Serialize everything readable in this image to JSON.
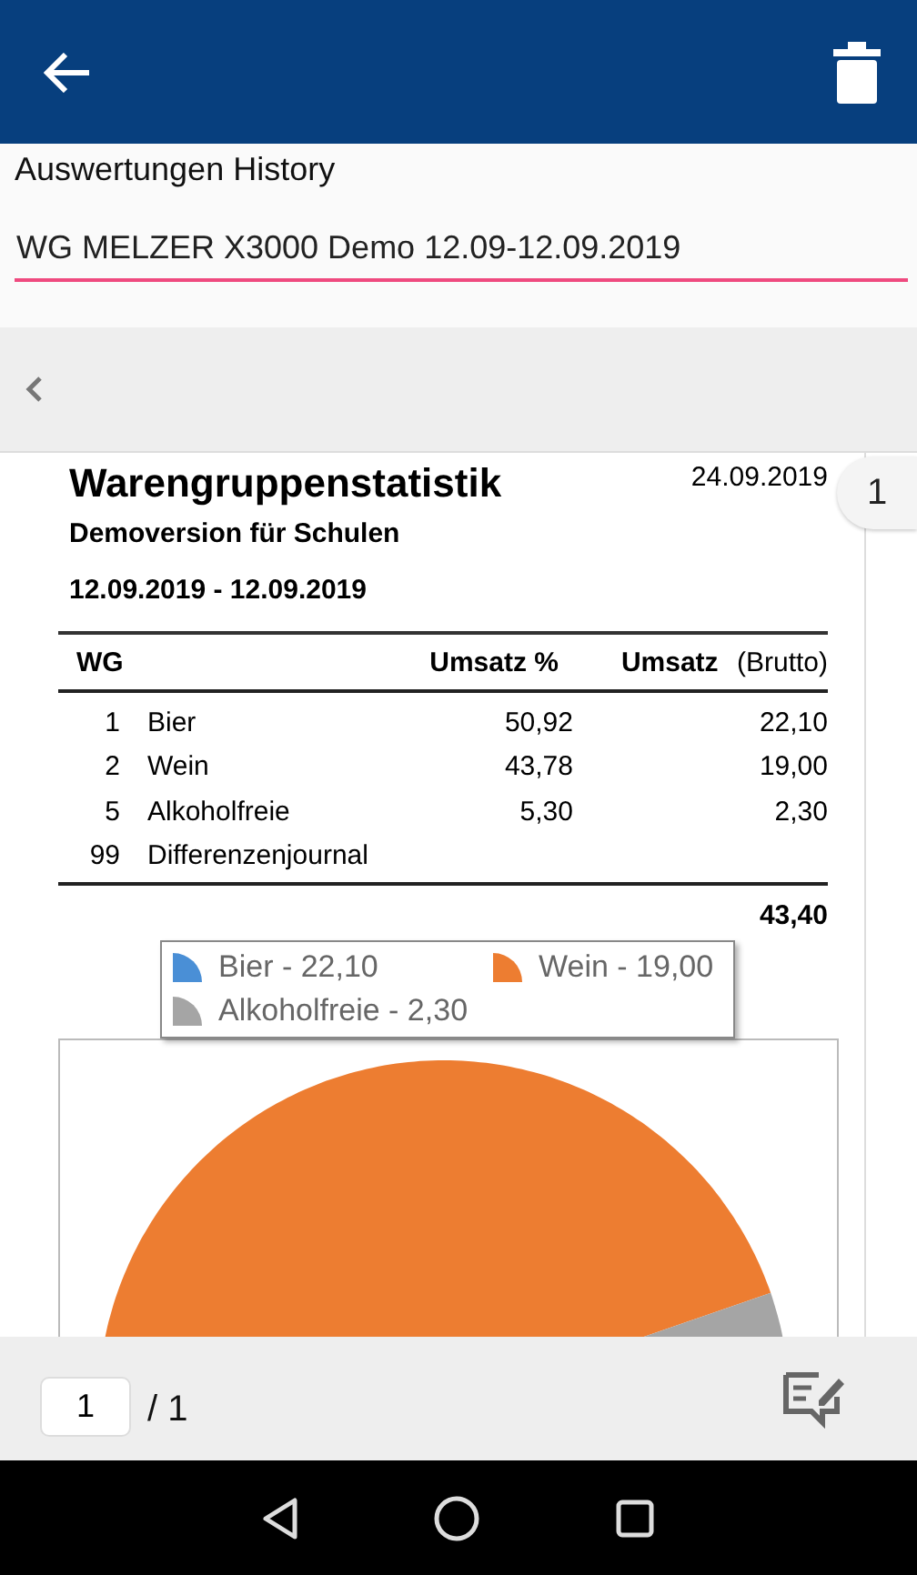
{
  "history": {
    "label": "Auswertungen History",
    "value": "WG MELZER X3000 Demo 12.09-12.09.2019"
  },
  "page_badge": "1",
  "report": {
    "title": "Warengruppenstatistik",
    "date": "24.09.2019",
    "subtitle": "Demoversion für Schulen",
    "period": "12.09.2019 - 12.09.2019",
    "columns": [
      "WG",
      "Umsatz %",
      "**Umsatz** (Brutto)"
    ],
    "rows": [
      {
        "wg": "1",
        "name": "Bier",
        "percent": "50,92",
        "amount": "22,10"
      },
      {
        "wg": "2",
        "name": "Wein",
        "percent": "43,78",
        "amount": "19,00"
      },
      {
        "wg": "5",
        "name": "Alkoholfreie",
        "percent": "5,30",
        "amount": "2,30"
      },
      {
        "wg": "99",
        "name": "Differenzenjournal"
      }
    ],
    "total": "43,40",
    "legend": [
      {
        "label": "Bier - 22,10",
        "color": "#4a8fd6"
      },
      {
        "label": "Wein - 19,00",
        "color": "#ed7d31"
      },
      {
        "label": "Alkoholfreie - 2,30",
        "color": "#a5a5a5"
      }
    ]
  },
  "pager": {
    "page": "1",
    "of": "/ 1"
  }
}
